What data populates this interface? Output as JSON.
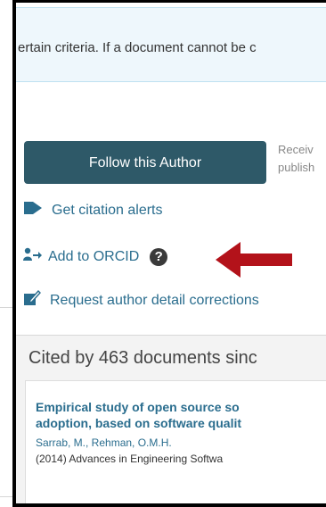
{
  "notice": {
    "text": "ertain criteria. If a document cannot be c"
  },
  "follow": {
    "button_label": "Follow this Author",
    "side_line1": "Receiv",
    "side_line2": "publish"
  },
  "actions": {
    "citation_alerts": "Get citation alerts",
    "add_orcid": "Add to ORCID",
    "help_glyph": "?",
    "request_corrections": "Request author detail corrections"
  },
  "cited": {
    "heading": "Cited by 463 documents sinc",
    "document": {
      "title_line1": "Empirical study of open source so",
      "title_line2": "adoption, based on software qualit",
      "authors": "Sarrab, M., Rehman, O.M.H.",
      "source": "(2014) Advances in Engineering Softwa"
    }
  },
  "colors": {
    "button_bg": "#2e5968",
    "link": "#2a6d8e",
    "arrow": "#b3121a",
    "notice_bg": "#eef7fc"
  },
  "icons": {
    "citation_alerts": "tag-icon",
    "add_orcid": "person-arrow-icon",
    "help": "question-circle-icon",
    "request_corrections": "edit-icon",
    "annotation": "red-arrow-icon"
  }
}
